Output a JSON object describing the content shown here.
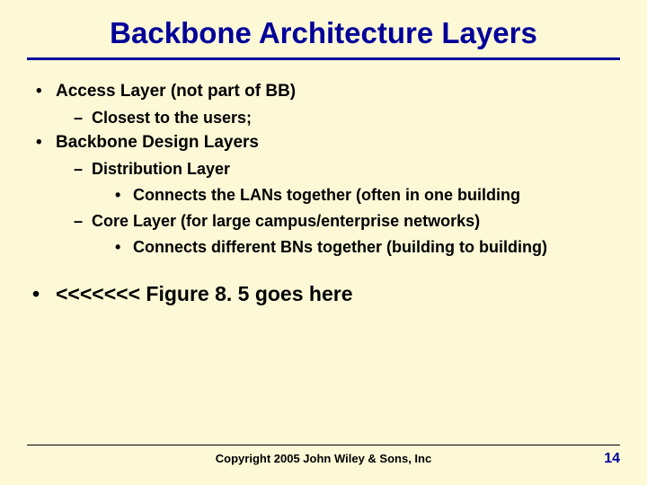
{
  "title": "Backbone Architecture Layers",
  "bullets": {
    "b1": "Access Layer (not part of BB)",
    "b1a": "Closest to the users;",
    "b2": "Backbone Design Layers",
    "b2a": "Distribution Layer",
    "b2a1": "Connects the LANs together (often in one building",
    "b2b": "Core Layer (for large campus/enterprise networks)",
    "b2b1": "Connects different BNs together (building to building)",
    "b3": "<<<<<<< Figure 8. 5 goes here"
  },
  "footer": {
    "copyright": "Copyright 2005 John Wiley & Sons, Inc",
    "page": "14"
  },
  "symbols": {
    "dot": "•",
    "dash": "–"
  }
}
